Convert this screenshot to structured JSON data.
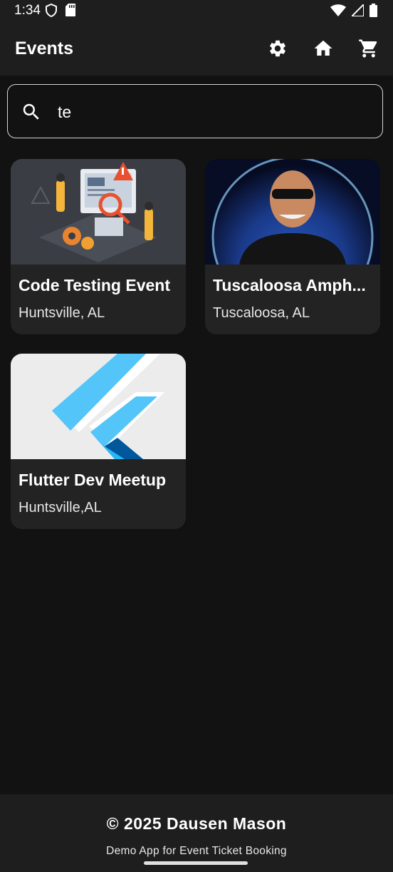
{
  "status": {
    "time": "1:34"
  },
  "appbar": {
    "title": "Events",
    "icons": [
      "gear-icon",
      "home-icon",
      "cart-icon"
    ]
  },
  "search": {
    "value": "te"
  },
  "events": [
    {
      "title": "Code Testing Event",
      "location": "Huntsville, AL"
    },
    {
      "title": "Tuscaloosa Amph...",
      "location": "Tuscaloosa, AL"
    },
    {
      "title": "Flutter Dev Meetup",
      "location": "Huntsville,AL"
    }
  ],
  "footer": {
    "title": "© 2025 Dausen Mason",
    "subtitle": "Demo App for Event Ticket Booking"
  },
  "colors": {
    "background": "#121212",
    "bar": "#1e1e1e",
    "card": "#232323",
    "flutter_light": "#54c5f8",
    "flutter_dark": "#01579b"
  }
}
